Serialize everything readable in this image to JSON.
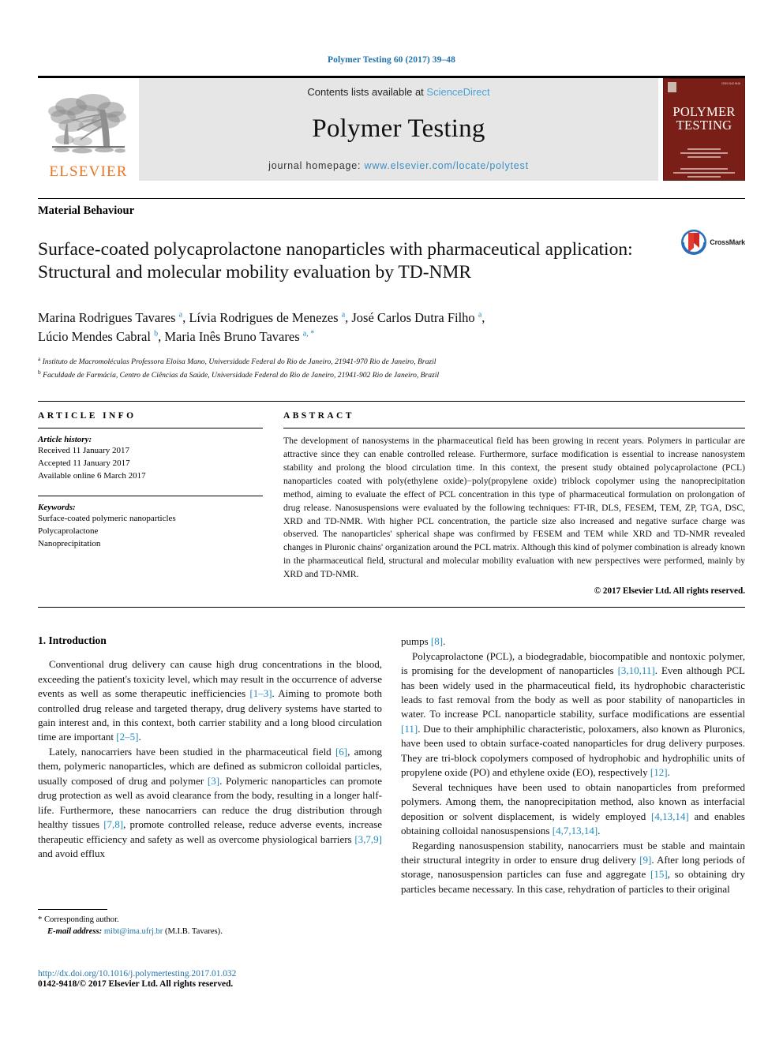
{
  "running_head": "Polymer Testing 60 (2017) 39–48",
  "masthead": {
    "publisher_name": "ELSEVIER",
    "contents_prefix": "Contents lists available at ",
    "contents_link": "ScienceDirect",
    "journal_name": "Polymer Testing",
    "homepage_prefix": "journal homepage: ",
    "homepage_url": "www.elsevier.com/locate/polytest",
    "cover_title_line1": "POLYMER",
    "cover_title_line2": "TESTING"
  },
  "article": {
    "section_label": "Material Behaviour",
    "title": "Surface-coated polycaprolactone nanoparticles with pharmaceutical application: Structural and molecular mobility evaluation by TD-NMR",
    "crossmark_label": "CrossMark",
    "authors_line1": "Marina Rodrigues Tavares ",
    "authors_line1_sup1": "a",
    "authors_line1_b": ", Lívia Rodrigues de Menezes ",
    "authors_line1_sup2": "a",
    "authors_line1_c": ", José Carlos Dutra Filho ",
    "authors_line1_sup3": "a",
    "authors_line1_d": ",",
    "authors_line2": "Lúcio Mendes Cabral ",
    "authors_line2_sup1": "b",
    "authors_line2_b": ", Maria Inês Bruno Tavares ",
    "authors_line2_sup2": "a, *",
    "affiliation_a_sup": "a",
    "affiliation_a": " Instituto de Macromoléculas Professora Eloisa Mano, Universidade Federal do Rio de Janeiro, 21941-970 Rio de Janeiro, Brazil",
    "affiliation_b_sup": "b",
    "affiliation_b": " Faculdade de Farmácia, Centro de Ciências da Saúde, Universidade Federal do Rio de Janeiro, 21941-902 Rio de Janeiro, Brazil"
  },
  "article_info": {
    "heading": "ARTICLE INFO",
    "history_label": "Article history:",
    "history": [
      "Received 11 January 2017",
      "Accepted 11 January 2017",
      "Available online 6 March 2017"
    ],
    "keywords_label": "Keywords:",
    "keywords": [
      "Surface-coated polymeric nanoparticles",
      "Polycaprolactone",
      "Nanoprecipitation"
    ]
  },
  "abstract": {
    "heading": "ABSTRACT",
    "text": "The development of nanosystems in the pharmaceutical field has been growing in recent years. Polymers in particular are attractive since they can enable controlled release. Furthermore, surface modification is essential to increase nanosystem stability and prolong the blood circulation time. In this context, the present study obtained polycaprolactone (PCL) nanoparticles coated with poly(ethylene oxide)−poly(propylene oxide) triblock copolymer using the nanoprecipitation method, aiming to evaluate the effect of PCL concentration in this type of pharmaceutical formulation on prolongation of drug release. Nanosuspensions were evaluated by the following techniques: FT-IR, DLS, FESEM, TEM, ZP, TGA, DSC, XRD and TD-NMR. With higher PCL concentration, the particle size also increased and negative surface charge was observed. The nanoparticles' spherical shape was confirmed by FESEM and TEM while XRD and TD-NMR revealed changes in Pluronic chains' organization around the PCL matrix. Although this kind of polymer combination is already known in the pharmaceutical field, structural and molecular mobility evaluation with new perspectives were performed, mainly by XRD and TD-NMR.",
    "copyright": "© 2017 Elsevier Ltd. All rights reserved."
  },
  "body": {
    "intro_heading": "1. Introduction",
    "left_paragraphs": [
      {
        "parts": [
          {
            "t": "Conventional drug delivery can cause high drug concentrations in the blood, exceeding the patient's toxicity level, which may result in the occurrence of adverse events as well as some therapeutic inefficiencies "
          },
          {
            "t": "[1–3]",
            "ref": true
          },
          {
            "t": ". Aiming to promote both controlled drug release and targeted therapy, drug delivery systems have started to gain interest and, in this context, both carrier stability and a long blood circulation time are important "
          },
          {
            "t": "[2–5]",
            "ref": true
          },
          {
            "t": "."
          }
        ]
      },
      {
        "parts": [
          {
            "t": "Lately, nanocarriers have been studied in the pharmaceutical field "
          },
          {
            "t": "[6]",
            "ref": true
          },
          {
            "t": ", among them, polymeric nanoparticles, which are defined as submicron colloidal particles, usually composed of drug and polymer "
          },
          {
            "t": "[3]",
            "ref": true
          },
          {
            "t": ". Polymeric nanoparticles can promote drug protection as well as avoid clearance from the body, resulting in a longer half-life. Furthermore, these nanocarriers can reduce the drug distribution through healthy tissues "
          },
          {
            "t": "[7,8]",
            "ref": true
          },
          {
            "t": ", promote controlled release, reduce adverse events, increase therapeutic efficiency and safety as well as overcome physiological barriers "
          },
          {
            "t": "[3,7,9]",
            "ref": true
          },
          {
            "t": " and avoid efflux"
          }
        ]
      }
    ],
    "right_paragraphs": [
      {
        "noindent": true,
        "parts": [
          {
            "t": "pumps "
          },
          {
            "t": "[8]",
            "ref": true
          },
          {
            "t": "."
          }
        ]
      },
      {
        "parts": [
          {
            "t": "Polycaprolactone (PCL), a biodegradable, biocompatible and nontoxic polymer, is promising for the development of nanoparticles "
          },
          {
            "t": "[3,10,11]",
            "ref": true
          },
          {
            "t": ". Even although PCL has been widely used in the pharmaceutical field, its hydrophobic characteristic leads to fast removal from the body as well as poor stability of nanoparticles in water. To increase PCL nanoparticle stability, surface modifications are essential "
          },
          {
            "t": "[11]",
            "ref": true
          },
          {
            "t": ". Due to their amphiphilic characteristic, poloxamers, also known as Pluronics, have been used to obtain surface-coated nanoparticles for drug delivery purposes. They are tri-block copolymers composed of hydrophobic and hydrophilic units of propylene oxide (PO) and ethylene oxide (EO), respectively "
          },
          {
            "t": "[12]",
            "ref": true
          },
          {
            "t": "."
          }
        ]
      },
      {
        "parts": [
          {
            "t": "Several techniques have been used to obtain nanoparticles from preformed polymers. Among them, the nanoprecipitation method, also known as interfacial deposition or solvent displacement, is widely employed "
          },
          {
            "t": "[4,13,14]",
            "ref": true
          },
          {
            "t": " and enables obtaining colloidal nanosuspensions "
          },
          {
            "t": "[4,7,13,14]",
            "ref": true
          },
          {
            "t": "."
          }
        ]
      },
      {
        "parts": [
          {
            "t": "Regarding nanosuspension stability, nanocarriers must be stable and maintain their structural integrity in order to ensure drug delivery "
          },
          {
            "t": "[9]",
            "ref": true
          },
          {
            "t": ". After long periods of storage, nanosuspension particles can fuse and aggregate "
          },
          {
            "t": "[15]",
            "ref": true
          },
          {
            "t": ", so obtaining dry particles became necessary. In this case, rehydration of particles to their original"
          }
        ]
      }
    ]
  },
  "footer": {
    "corresponding_marker": "*",
    "corresponding_text": "Corresponding author.",
    "email_label": "E-mail address:",
    "email": "mibt@ima.ufrj.br",
    "email_owner": "(M.I.B. Tavares).",
    "doi": "http://dx.doi.org/10.1016/j.polymertesting.2017.01.032",
    "issn_line": "0142-9418/© 2017 Elsevier Ltd. All rights reserved."
  },
  "colors": {
    "link_blue": "#1f72ab",
    "ref_blue": "#1f8ac0",
    "elsevier_orange": "#E87722",
    "cover_maroon": "#7a1f17",
    "masthead_grey": "#e6e6e6"
  }
}
